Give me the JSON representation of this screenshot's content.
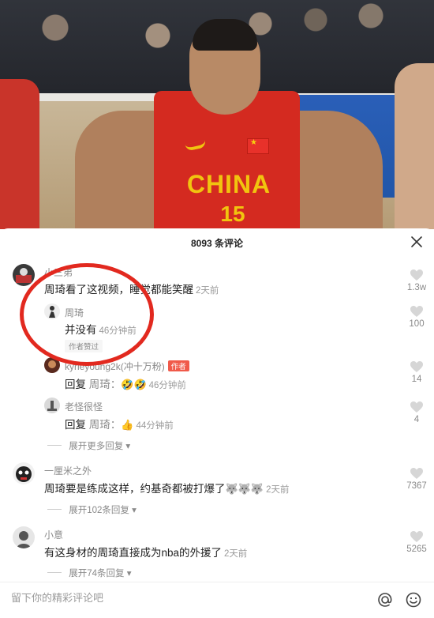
{
  "video": {
    "jersey_text": "CHINA",
    "jersey_number": "15"
  },
  "sheet": {
    "title": "8093 条评论"
  },
  "comments": [
    {
      "name": "小三弟",
      "text": "周琦看了这视频，睡觉都能笑醒",
      "time": "2天前",
      "likes": "1.3w",
      "replies": [
        {
          "name": "周琦",
          "text": "并没有",
          "time": "46分钟前",
          "tag": "作者赞过"
        },
        {
          "name": "kyrieyoung2k(冲十万粉)",
          "badge": "作者",
          "prefix": "回复",
          "target": "周琦：",
          "emoji": "🤣🤣",
          "time": "46分钟前",
          "likes": "14"
        },
        {
          "name": "老怪很怪",
          "prefix": "回复",
          "target": "周琦：",
          "emoji": "👍",
          "time": "44分钟前",
          "likes": "4"
        }
      ],
      "reply_likes_first": "100",
      "expand": "展开更多回复"
    },
    {
      "name": "一厘米之外",
      "text": "周琦要是练成这样，约基奇都被打爆了",
      "emoji": "🐺🐺🐺",
      "time": "2天前",
      "likes": "7367",
      "expand": "展开102条回复"
    },
    {
      "name": "小意",
      "text": "有这身材的周琦直接成为nba的外援了",
      "time": "2天前",
      "likes": "5265",
      "expand": "展开74条回复"
    }
  ],
  "input": {
    "placeholder": "留下你的精彩评论吧"
  },
  "colors": {
    "annotation_circle": "#e2291f",
    "author_badge": "#f05a4a"
  },
  "icons": [
    "close-icon",
    "heart-icon",
    "at-icon",
    "emoji-icon",
    "chevron-down-icon"
  ]
}
